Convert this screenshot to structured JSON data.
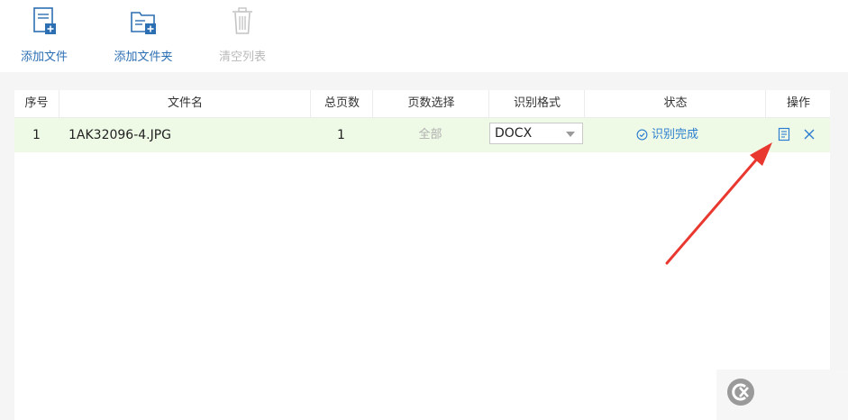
{
  "toolbar": {
    "add_file_label": "添加文件",
    "add_folder_label": "添加文件夹",
    "clear_list_label": "清空列表"
  },
  "table": {
    "headers": {
      "index": "序号",
      "filename": "文件名",
      "total_pages": "总页数",
      "page_select": "页数选择",
      "format": "识别格式",
      "status": "状态",
      "actions": "操作"
    },
    "rows": [
      {
        "index": "1",
        "filename": "1AK32096-4.JPG",
        "total_pages": "1",
        "page_select": "全部",
        "format": "DOCX",
        "status": "识别完成"
      }
    ]
  },
  "icons": {
    "add_file": "file-add-icon",
    "add_folder": "folder-add-icon",
    "clear_list": "trash-icon",
    "status_done": "check-circle-icon",
    "open_doc": "document-icon",
    "delete": "close-icon",
    "dropdown": "caret-down-icon"
  },
  "colors": {
    "accent": "#2c6fb3",
    "row_highlight": "#eef9e6",
    "status_done": "#2c7fd0",
    "annotation_arrow": "#e8382f"
  }
}
